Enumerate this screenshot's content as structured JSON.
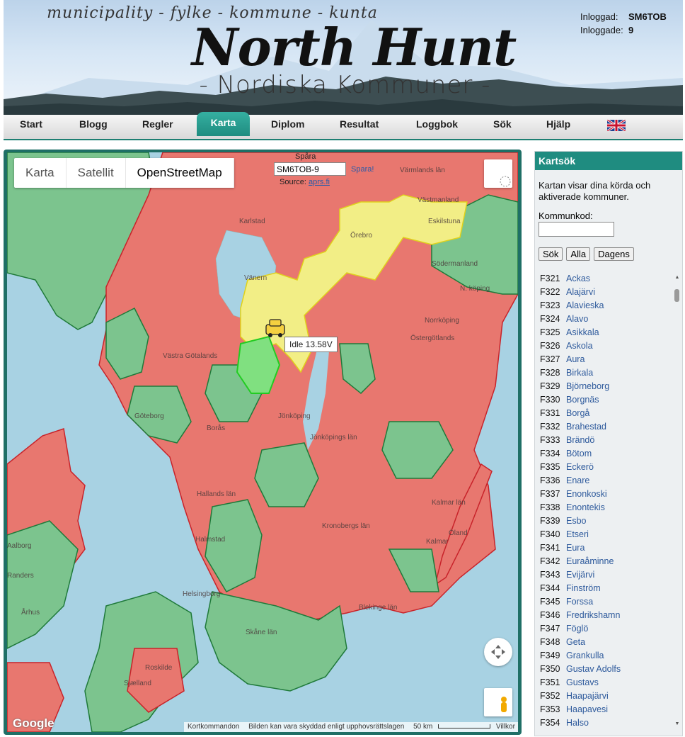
{
  "header": {
    "tagline": "municipality - fylke - kommune - kunta",
    "brand": "North Hunt",
    "subtitle": "- Nordiska Kommuner -",
    "login_label": "Inloggad:",
    "login_user": "SM6TOB",
    "count_label": "Inloggade:",
    "count_value": "9"
  },
  "nav": {
    "items": [
      "Start",
      "Blogg",
      "Regler",
      "Karta",
      "Diplom",
      "Resultat",
      "Loggbok",
      "Sök",
      "Hjälp"
    ],
    "active": "Karta",
    "flag_icon": "uk-flag-icon"
  },
  "map": {
    "types": [
      "Karta",
      "Satellit",
      "OpenStreetMap"
    ],
    "selected_type": "OpenStreetMap",
    "track_label": "Spåra",
    "track_value": "SM6TOB-9",
    "track_save": "Spara!",
    "source_label": "Source:",
    "source_link": "aprs.fi",
    "marker_label": "Idle 13.58V",
    "marker_icon": "car-icon",
    "places": {
      "karlstad": "Karlstad",
      "orebro": "Örebro",
      "eskilstuna": "Eskilstuna",
      "vanern": "Vänern",
      "nkoping": "N. köping",
      "norrkoping": "Norrköping",
      "ostergotlands": "Östergötlands",
      "vastra": "Västra Götalands",
      "goteborg": "Göteborg",
      "boras": "Borås",
      "jonkoping": "Jönköping",
      "jonkopings_lan": "Jönköpings län",
      "hallands": "Hallands län",
      "halmstad": "Halmstad",
      "kronobergs": "Kronobergs län",
      "kalmar_lan": "Kalmar län",
      "kalmar": "Kalmar",
      "oland": "Öland",
      "blekinge": "Blekinge län",
      "skane": "Skåne län",
      "helsingborg": "Helsingborg",
      "aalborg": "Aalborg",
      "randers": "Randers",
      "arhus": "Århus",
      "roskilde": "Roskilde",
      "sjaelland": "Sjælland",
      "vastmanland": "Västmanland",
      "sodermanland": "Södermanland",
      "varmlands": "Värmlands län"
    },
    "attribution": [
      "Kortkommandon",
      "Bilden kan vara skyddad enligt upphovsrättslagen",
      "50 km",
      "Villkor"
    ],
    "google": "Google",
    "colors": {
      "red": "#e8776f",
      "green": "#7cc48e",
      "yellow": "#f2ee86",
      "water": "#a8d2e3"
    }
  },
  "sidebar": {
    "title": "Kartsök",
    "description": "Kartan visar dina körda och aktiverade kommuner.",
    "code_label": "Kommunkod:",
    "code_value": "",
    "buttons": [
      "Sök",
      "Alla",
      "Dagens"
    ],
    "items": [
      {
        "code": "F321",
        "name": "Ackas"
      },
      {
        "code": "F322",
        "name": "Alajärvi"
      },
      {
        "code": "F323",
        "name": "Alavieska"
      },
      {
        "code": "F324",
        "name": "Alavo"
      },
      {
        "code": "F325",
        "name": "Asikkala"
      },
      {
        "code": "F326",
        "name": "Askola"
      },
      {
        "code": "F327",
        "name": "Aura"
      },
      {
        "code": "F328",
        "name": "Birkala"
      },
      {
        "code": "F329",
        "name": "Björneborg"
      },
      {
        "code": "F330",
        "name": "Borgnäs"
      },
      {
        "code": "F331",
        "name": "Borgå"
      },
      {
        "code": "F332",
        "name": "Brahestad"
      },
      {
        "code": "F333",
        "name": "Brändö"
      },
      {
        "code": "F334",
        "name": "Bötom"
      },
      {
        "code": "F335",
        "name": "Eckerö"
      },
      {
        "code": "F336",
        "name": "Enare"
      },
      {
        "code": "F337",
        "name": "Enonkoski"
      },
      {
        "code": "F338",
        "name": "Enontekis"
      },
      {
        "code": "F339",
        "name": "Esbo"
      },
      {
        "code": "F340",
        "name": "Etseri"
      },
      {
        "code": "F341",
        "name": "Eura"
      },
      {
        "code": "F342",
        "name": "Euraåminne"
      },
      {
        "code": "F343",
        "name": "Evijärvi"
      },
      {
        "code": "F344",
        "name": "Finström"
      },
      {
        "code": "F345",
        "name": "Forssa"
      },
      {
        "code": "F346",
        "name": "Fredrikshamn"
      },
      {
        "code": "F347",
        "name": "Föglö"
      },
      {
        "code": "F348",
        "name": "Geta"
      },
      {
        "code": "F349",
        "name": "Grankulla"
      },
      {
        "code": "F350",
        "name": "Gustav Adolfs"
      },
      {
        "code": "F351",
        "name": "Gustavs"
      },
      {
        "code": "F352",
        "name": "Haapajärvi"
      },
      {
        "code": "F353",
        "name": "Haapavesi"
      },
      {
        "code": "F354",
        "name": "Halso"
      }
    ]
  }
}
